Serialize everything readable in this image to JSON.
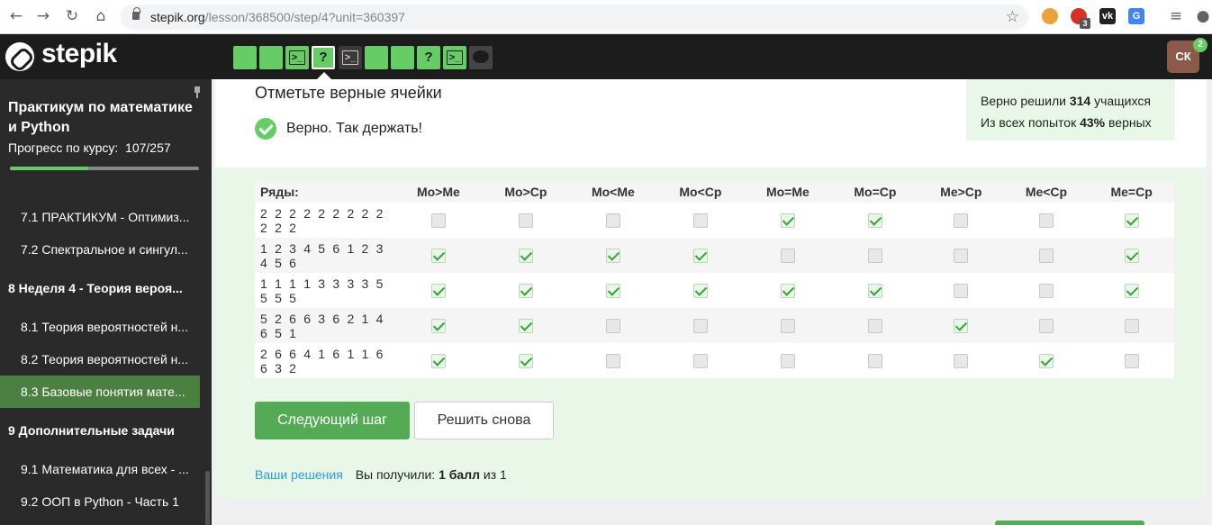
{
  "browser": {
    "url_host": "stepik.org",
    "url_path": "/lesson/368500/step/4?unit=360397",
    "ext_badge": "3"
  },
  "header": {
    "logo": "stepik",
    "avatar": "СК",
    "notifications": "2",
    "steps": [
      {
        "type": "text",
        "state": "passed"
      },
      {
        "type": "text",
        "state": "passed"
      },
      {
        "type": "code",
        "state": "passed"
      },
      {
        "type": "quiz",
        "state": "current"
      },
      {
        "type": "code",
        "state": "unsolved"
      },
      {
        "type": "text",
        "state": "passed"
      },
      {
        "type": "text",
        "state": "passed"
      },
      {
        "type": "quiz",
        "state": "passed"
      },
      {
        "type": "code",
        "state": "passed"
      },
      {
        "type": "discussion",
        "state": "unsolved"
      }
    ]
  },
  "sidebar": {
    "course_title": "Практикум по математике и Python",
    "progress_label": "Прогресс по курсу:",
    "progress_value": "107/257",
    "progress_fraction": 0.416,
    "items": [
      {
        "label": "7.1  ПРАКТИКУМ - Оптимиз...",
        "kind": "lesson"
      },
      {
        "label": "7.2  Спектральное и сингул...",
        "kind": "lesson"
      },
      {
        "label": "8  Неделя 4 - Теория вероя...",
        "kind": "section"
      },
      {
        "label": "8.1  Теория вероятностей н...",
        "kind": "lesson"
      },
      {
        "label": "8.2  Теория вероятностей н...",
        "kind": "lesson"
      },
      {
        "label": "8.3  Базовые понятия мате...",
        "kind": "lesson",
        "active": true
      },
      {
        "label": "9  Дополнительные задачи",
        "kind": "section"
      },
      {
        "label": "9.1  Математика для всех - ...",
        "kind": "lesson"
      },
      {
        "label": "9.2  ООП в Python - Часть 1",
        "kind": "lesson"
      }
    ]
  },
  "task": {
    "title": "Отметьте верные ячейки",
    "result": "Верно. Так держать!",
    "stats_line1_pre": "Верно решили ",
    "stats_line1_num": "314",
    "stats_line1_post": " учащихся",
    "stats_line2_pre": "Из всех попыток ",
    "stats_line2_num": "43%",
    "stats_line2_post": " верных"
  },
  "table": {
    "row_header": "Ряды:",
    "columns": [
      "Mo>Me",
      "Mo>Cp",
      "Mo<Me",
      "Mo<Cp",
      "Mo=Me",
      "Mo=Cp",
      "Me>Cp",
      "Me<Cp",
      "Me=Cp"
    ],
    "rows": [
      {
        "label": "2 2 2 2 2 2 2 2 2 2 2 2",
        "checks": [
          0,
          0,
          0,
          0,
          1,
          1,
          0,
          0,
          1
        ]
      },
      {
        "label": "1 2 3 4 5 6 1 2 3 4 5 6",
        "checks": [
          1,
          1,
          1,
          1,
          0,
          0,
          0,
          0,
          1
        ]
      },
      {
        "label": "1 1 1 1 3 3 3 3 5 5 5 5",
        "checks": [
          1,
          1,
          1,
          1,
          1,
          1,
          0,
          0,
          1
        ]
      },
      {
        "label": "5 2 6 6 3 6 2 1 4 6 5 1",
        "checks": [
          1,
          1,
          0,
          0,
          0,
          0,
          1,
          0,
          0
        ]
      },
      {
        "label": "2 6 6 4 1 6 1 1 6 6 3 2",
        "checks": [
          1,
          1,
          0,
          0,
          0,
          0,
          0,
          1,
          0
        ]
      }
    ]
  },
  "actions": {
    "next_step": "Следующий шаг",
    "solve_again": "Решить снова"
  },
  "footer": {
    "solutions_link": "Ваши решения",
    "got_pre": "Вы получили: ",
    "got_score": "1 балл",
    "got_post": " из 1"
  }
}
